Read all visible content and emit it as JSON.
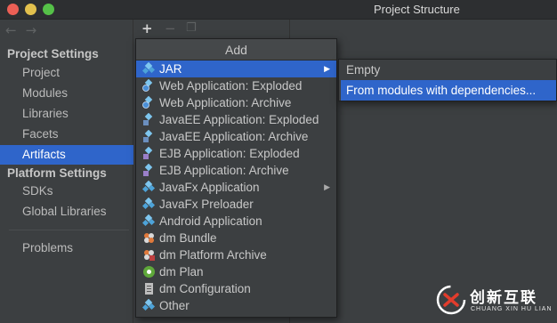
{
  "window": {
    "title": "Project Structure"
  },
  "colors": {
    "selection": "#2f65ca",
    "background": "#3c3f41",
    "text": "#bbbbbb"
  },
  "toolbar": {
    "add_icon": "plus-icon",
    "remove_icon": "minus-icon",
    "copy_icon": "copy-icon"
  },
  "sidebar": {
    "sections": [
      {
        "title": "Project Settings",
        "items": [
          "Project",
          "Modules",
          "Libraries",
          "Facets",
          "Artifacts"
        ]
      },
      {
        "title": "Platform Settings",
        "items": [
          "SDKs",
          "Global Libraries"
        ]
      }
    ],
    "extra_items": [
      "Problems"
    ],
    "selected": "Artifacts"
  },
  "add_popup": {
    "title": "Add",
    "items": [
      {
        "label": "JAR",
        "icon": "jar-icon",
        "submenu": true,
        "selected": true
      },
      {
        "label": "Web Application: Exploded",
        "icon": "web-app-icon"
      },
      {
        "label": "Web Application: Archive",
        "icon": "web-app-icon"
      },
      {
        "label": "JavaEE Application: Exploded",
        "icon": "javaee-icon"
      },
      {
        "label": "JavaEE Application: Archive",
        "icon": "javaee-icon"
      },
      {
        "label": "EJB Application: Exploded",
        "icon": "ejb-icon"
      },
      {
        "label": "EJB Application: Archive",
        "icon": "ejb-icon"
      },
      {
        "label": "JavaFx Application",
        "icon": "javafx-icon",
        "submenu": true
      },
      {
        "label": "JavaFx Preloader",
        "icon": "javafx-icon"
      },
      {
        "label": "Android Application",
        "icon": "android-icon"
      },
      {
        "label": "dm Bundle",
        "icon": "dm-bundle-icon"
      },
      {
        "label": "dm Platform Archive",
        "icon": "dm-archive-icon"
      },
      {
        "label": "dm Plan",
        "icon": "dm-plan-icon"
      },
      {
        "label": "dm Configuration",
        "icon": "dm-config-icon"
      },
      {
        "label": "Other",
        "icon": "artifact-icon"
      }
    ]
  },
  "jar_submenu": {
    "items": [
      {
        "label": "Empty"
      },
      {
        "label": "From modules with dependencies...",
        "selected": true
      }
    ]
  },
  "watermark": {
    "text": "创新互联",
    "subtext": "CHUANG XIN HU LIAN"
  }
}
